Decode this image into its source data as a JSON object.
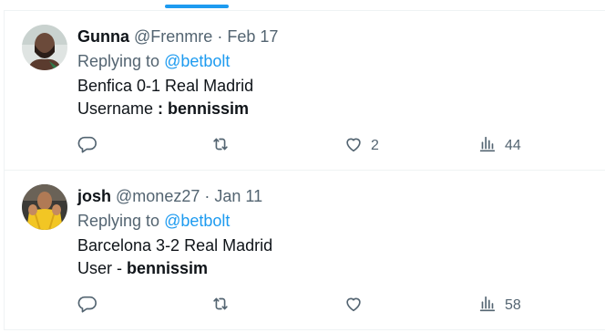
{
  "tweets": [
    {
      "name": "Gunna",
      "handle": "@Frenmre",
      "separator": "·",
      "date": "Feb 17",
      "replying_prefix": "Replying to",
      "replying_handle": "@betbolt",
      "line1": "Benfica 0-1 Real Madrid",
      "line2_prefix": "Username",
      "line2_sep": " : ",
      "line2_bold": "bennissim",
      "likes": "2",
      "views": "44"
    },
    {
      "name": "josh",
      "handle": "@monez27",
      "separator": "·",
      "date": "Jan 11",
      "replying_prefix": "Replying to",
      "replying_handle": "@betbolt",
      "line1": "Barcelona 3-2 Real Madrid",
      "line2_prefix": "User",
      "line2_sep": " - ",
      "line2_bold": "bennissim",
      "likes": "",
      "views": "58"
    }
  ],
  "icons": {
    "reply": "reply-icon",
    "retweet": "retweet-icon",
    "like": "heart-icon",
    "views": "views-chart-icon"
  },
  "colors": {
    "accent": "#1d9bf0",
    "text": "#0f1419",
    "secondary": "#536471",
    "border": "#eff3f4"
  }
}
